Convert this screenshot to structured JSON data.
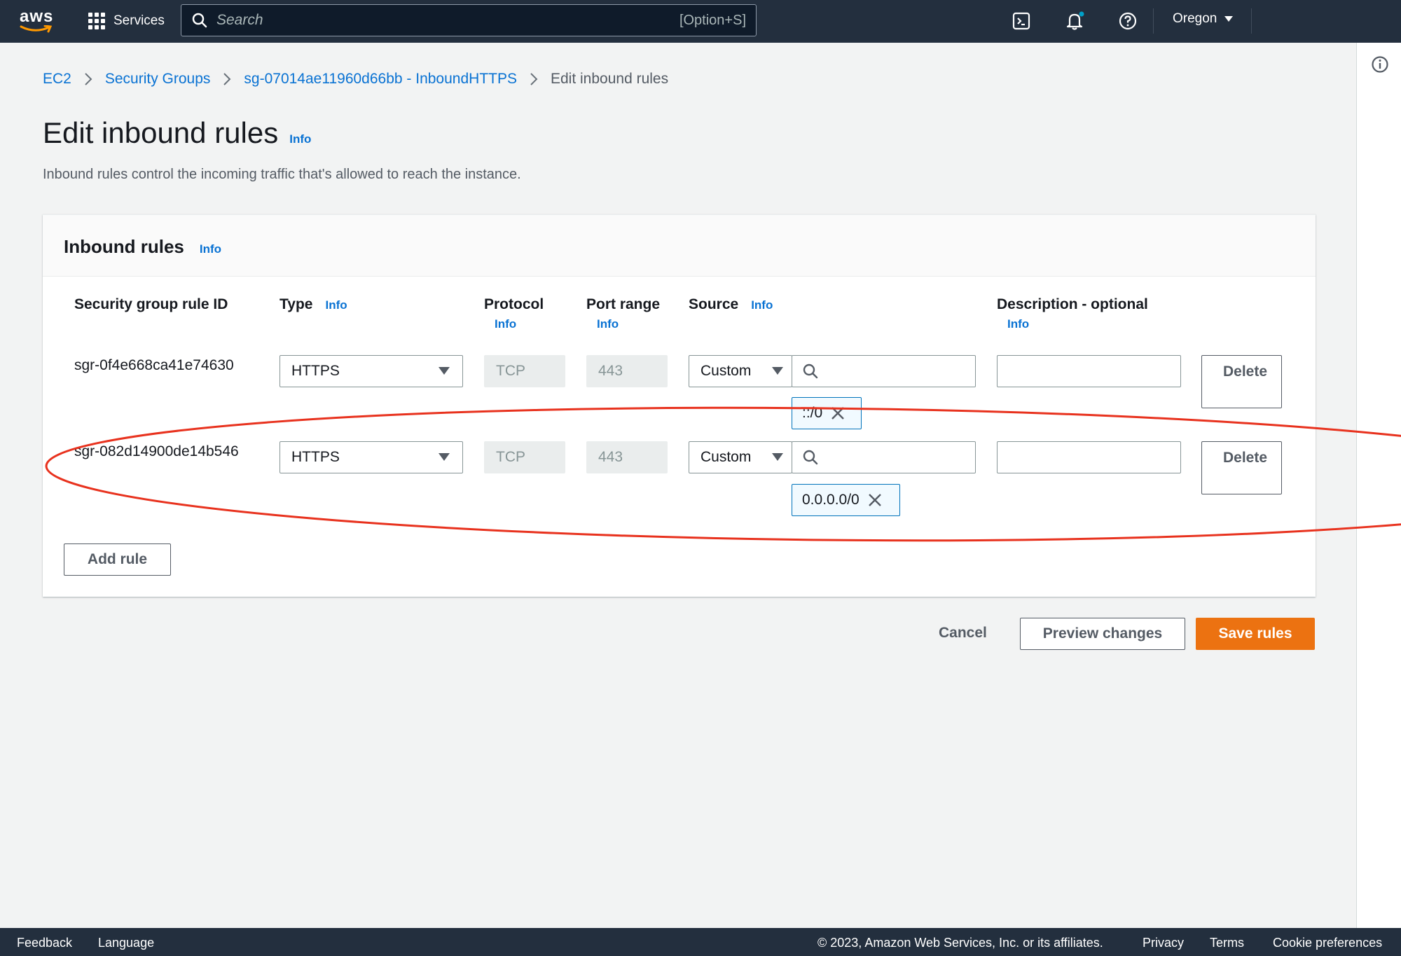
{
  "topnav": {
    "logo_text": "aws",
    "services_label": "Services",
    "search_placeholder": "Search",
    "search_shortcut": "[Option+S]",
    "region": "Oregon",
    "icons": [
      "cloudshell-icon",
      "bell-icon",
      "help-icon"
    ]
  },
  "breadcrumb": {
    "items": [
      "EC2",
      "Security Groups",
      "sg-07014ae11960d66bb - InboundHTTPS"
    ],
    "current": "Edit inbound rules"
  },
  "page": {
    "title": "Edit inbound rules",
    "info": "Info",
    "description": "Inbound rules control the incoming traffic that's allowed to reach the instance."
  },
  "panel": {
    "title": "Inbound rules",
    "info": "Info",
    "columns": {
      "rule_id": "Security group rule ID",
      "type": "Type",
      "protocol": "Protocol",
      "port_range": "Port range",
      "source": "Source",
      "description": "Description - optional",
      "info": "Info"
    },
    "rules": [
      {
        "id": "sgr-0f4e668ca41e74630",
        "type": "HTTPS",
        "protocol": "TCP",
        "port": "443",
        "source_mode": "Custom",
        "source_value": "",
        "cidr": "::/0",
        "description": "",
        "delete_label": "Delete"
      },
      {
        "id": "sgr-082d14900de14b546",
        "type": "HTTPS",
        "protocol": "TCP",
        "port": "443",
        "source_mode": "Custom",
        "source_value": "",
        "cidr": "0.0.0.0/0",
        "description": "",
        "delete_label": "Delete"
      }
    ],
    "add_rule_label": "Add rule"
  },
  "actions": {
    "cancel": "Cancel",
    "preview": "Preview changes",
    "save": "Save rules"
  },
  "footer": {
    "feedback": "Feedback",
    "language": "Language",
    "copyright": "© 2023, Amazon Web Services, Inc. or its affiliates.",
    "privacy": "Privacy",
    "terms": "Terms",
    "cookie": "Cookie preferences"
  },
  "colors": {
    "nav_bg": "#232f3e",
    "link": "#0972d3",
    "primary": "#ec7211",
    "annotation": "#e8321e"
  }
}
